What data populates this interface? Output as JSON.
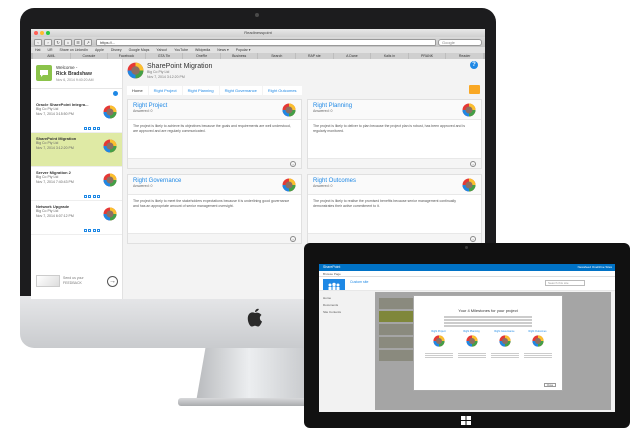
{
  "browser": {
    "window_title": "Readinesspoint",
    "url": "https://...",
    "search_placeholder": "Google",
    "bookmarks": [
      "Hat",
      "UR",
      "Share on LinkedIn",
      "Apple",
      "Disney",
      "Google Maps",
      "Yahoo!",
      "YouTube",
      "Wikipedia",
      "News ▾",
      "Popular ▾"
    ],
    "tabs": [
      "AMIL",
      "Console",
      "Facebook",
      "GTA Tin",
      "OneRe",
      "Business",
      "Search",
      "RAP ste",
      "A Dane",
      "Kalis in",
      "PRANK",
      "Reader"
    ]
  },
  "sidebar": {
    "welcome_label": "Welcome -",
    "user_name": "Rick Bradshaw",
    "login_date": "Nov 6, 2014 9:40:20 AM",
    "projects": [
      {
        "title": "Oracle SharePoint Integra...",
        "subtitle": "Big Co Pty Ltd",
        "date": "Nov 7, 2014 3:15:50 PM"
      },
      {
        "title": "SharePoint Migration",
        "subtitle": "Big Co Pty Ltd",
        "date": "Nov 7, 2014 3:12:20 PM"
      },
      {
        "title": "Server Migration 2",
        "subtitle": "Big Co Pty Ltd",
        "date": "Nov 7, 2014 7:40:43 PM"
      },
      {
        "title": "Network Upgrade",
        "subtitle": "Big Co Pty Ltd",
        "date": "Nov 7, 2014 6:07:12 PM"
      }
    ],
    "feedback_line1": "Send us your",
    "feedback_line2": "FEEDBACK"
  },
  "main": {
    "project_title": "SharePoint Migration",
    "project_org": "Big Co Pty Ltd",
    "project_date": "Nov 7, 2014 3:12:20 PM",
    "help": "?",
    "tabs": [
      "Home",
      "Right Project",
      "Right Planning",
      "Right Governance",
      "Right Outcomes"
    ],
    "cards": [
      {
        "title": "Right Project",
        "answered": "Answered: 0",
        "body": "The project is likely to achieve its objectives because the goals and requirements are well understood, are approved and are regularly communicated."
      },
      {
        "title": "Right Planning",
        "answered": "Answered: 0",
        "body": "The project is likely to deliver to plan because the project plan is robust, has been approved and is regularly monitored."
      },
      {
        "title": "Right Governance",
        "answered": "Answered: 0",
        "body": "The project is likely to meet the stakeholders expectations because it is underlining good governance and has an appropriate amount of senior management oversight."
      },
      {
        "title": "Right Outcomes",
        "answered": "Answered: 0",
        "body": "The project is likely to realise the promised benefits because senior management continually demonstrates their active commitment to it."
      }
    ],
    "card_footer_icon": "arrow-right-icon"
  },
  "tablet": {
    "brand": "SharePoint",
    "top_links": "Newsfeed   OneDrive   Sites",
    "subnav": "Browse   Page",
    "breadcrumb": "Custom site",
    "search_placeholder": "Search this site",
    "left_nav": [
      "Home",
      "Documents",
      "Site Contents"
    ],
    "modal_title": "Your 4 Milestones for your project",
    "modal_cols": [
      "Right Project",
      "Right Planning",
      "Right Governance",
      "Right Outcomes"
    ],
    "modal_close": "Close"
  },
  "colors": {
    "accent_blue": "#1e88e5",
    "highlight_green": "#dfeaa5",
    "logo_green": "#8bc34a",
    "orange": "#f9a825",
    "sharepoint_blue": "#0072c6"
  }
}
